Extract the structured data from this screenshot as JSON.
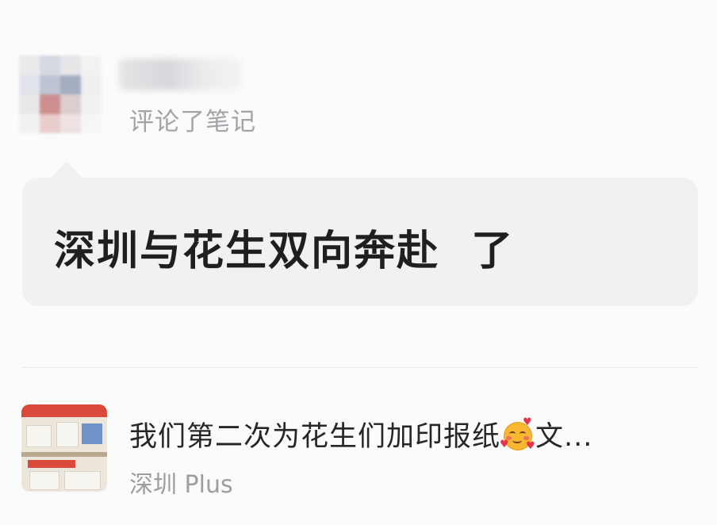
{
  "comment_card": {
    "action": "评论了笔记",
    "comment": "深圳与花生双向奔赴  了"
  },
  "note": {
    "title": "我们第二次为花生们加印报纸",
    "emoji": "smiling-face-with-hearts-icon",
    "title_suffix": "文...",
    "source": "深圳 Plus"
  },
  "colors": {
    "background": "#fbfbfb",
    "bubble": "#f1f1f3",
    "comment_text": "#1f1f1f",
    "secondary_text": "#a3a3a8"
  }
}
